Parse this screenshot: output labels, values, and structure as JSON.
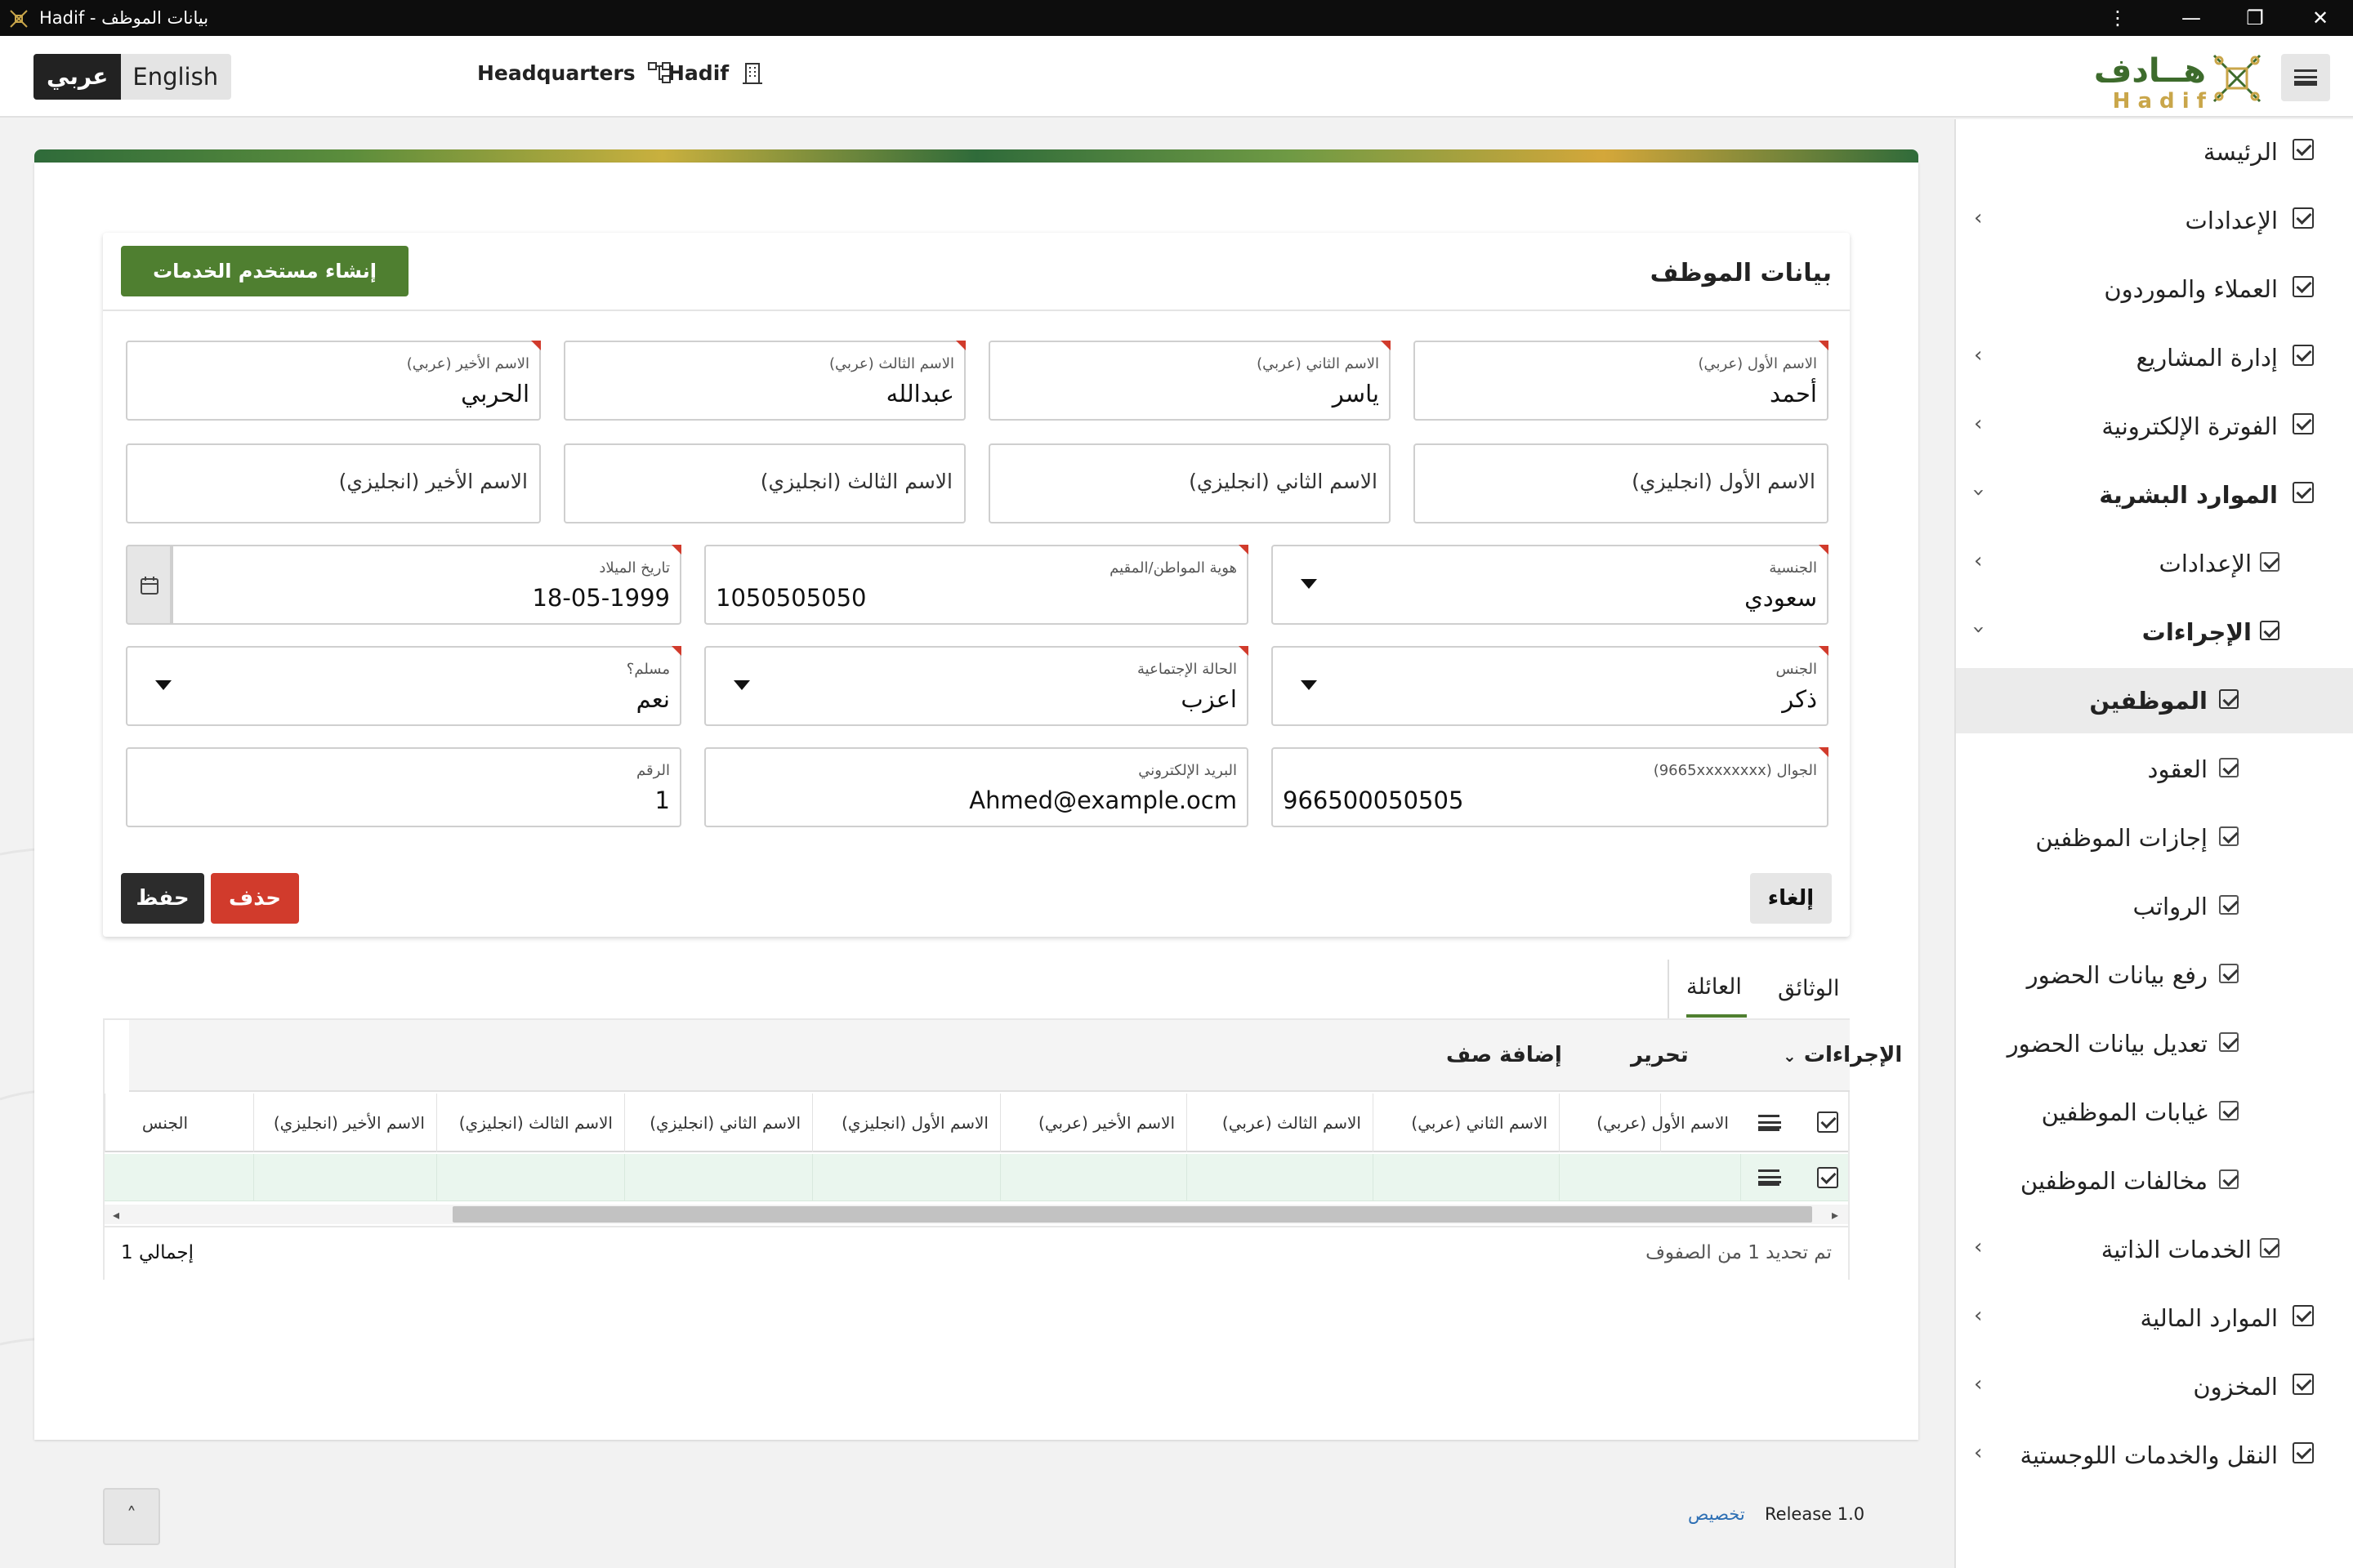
{
  "window": {
    "title": "Hadif - بيانات الموظف"
  },
  "header": {
    "lang_arabic": "عربي",
    "lang_english": "English",
    "org_unit": "Headquarters",
    "company": "Hadif",
    "logo_arabic": "هــادف",
    "logo_latin": "H a d i f"
  },
  "sidebar": {
    "items": [
      {
        "label": "الرئيسة"
      },
      {
        "label": "الإعدادات"
      },
      {
        "label": "العملاء والموردون"
      },
      {
        "label": "إدارة المشاريع"
      },
      {
        "label": "الفوترة الإلكترونية"
      },
      {
        "label": "الموارد البشرية"
      },
      {
        "label": "الإعدادات"
      },
      {
        "label": "الإجراءات"
      },
      {
        "label": "الموظفين"
      },
      {
        "label": "العقود"
      },
      {
        "label": "إجازات الموظفين"
      },
      {
        "label": "الرواتب"
      },
      {
        "label": "رفع بيانات الحضور"
      },
      {
        "label": "تعديل بيانات الحضور"
      },
      {
        "label": "غيابات الموظفين"
      },
      {
        "label": "مخالفات الموظفين"
      },
      {
        "label": "الخدمات الذاتية"
      },
      {
        "label": "الموارد المالية"
      },
      {
        "label": "المخزون"
      },
      {
        "label": "النقل والخدمات اللوجستية"
      }
    ]
  },
  "form": {
    "title": "بيانات الموظف",
    "create_self_service_button": "إنشاء مستخدم الخدمات الذاتية",
    "first_name_ar": {
      "label": "الاسم الأول (عربي)",
      "value": "أحمد"
    },
    "second_name_ar": {
      "label": "الاسم الثاني (عربي)",
      "value": "ياسر"
    },
    "third_name_ar": {
      "label": "الاسم الثالث (عربي)",
      "value": "عبدالله"
    },
    "last_name_ar": {
      "label": "الاسم الأخير (عربي)",
      "value": "الحربي"
    },
    "first_name_en": {
      "placeholder": "الاسم الأول (انجليزي)"
    },
    "second_name_en": {
      "placeholder": "الاسم الثاني (انجليزي)"
    },
    "third_name_en": {
      "placeholder": "الاسم الثالث (انجليزي)"
    },
    "last_name_en": {
      "placeholder": "الاسم الأخير (انجليزي)"
    },
    "nationality": {
      "label": "الجنسية",
      "value": "سعودي"
    },
    "national_id": {
      "label": "هوية المواطن/المقيم",
      "value": "1050505050"
    },
    "birth_date": {
      "label": "تاريخ الميلاد",
      "value": "18-05-1999"
    },
    "gender": {
      "label": "الجنس",
      "value": "ذكر"
    },
    "marital_status": {
      "label": "الحالة الإجتماعية",
      "value": "اعزب"
    },
    "muslim": {
      "label": "مسلم؟",
      "value": "نعم"
    },
    "mobile": {
      "label": "الجوال (9665xxxxxxxx)",
      "value": "966500050505"
    },
    "email": {
      "label": "البريد الإلكتروني",
      "value": "Ahmed@example.ocm"
    },
    "number": {
      "label": "الرقم",
      "value": "1"
    },
    "save_button": "حفظ",
    "delete_button": "حذف",
    "cancel_button": "إلغاء"
  },
  "tabs": {
    "documents": "الوثائق",
    "family": "العائلة"
  },
  "grid": {
    "actions_menu": "الإجراءات",
    "edit": "تحرير",
    "add_row": "إضافة صف",
    "columns": [
      "الاسم الأول (عربي)",
      "الاسم الثاني (عربي)",
      "الاسم الثالث (عربي)",
      "الاسم الأخير (عربي)",
      "الاسم الأول (انجليزي)",
      "الاسم الثاني (انجليزي)",
      "الاسم الثالث (انجليزي)",
      "الاسم الأخير (انجليزي)",
      "الجنس"
    ],
    "selection_status": "تم تحديد 1 من الصفوف",
    "total": "إجمالي 1"
  },
  "footer": {
    "release": "Release 1.0",
    "customize": "تخصيص"
  },
  "colors": {
    "brand_green": "#4f7f30",
    "delete_red": "#d13b2c",
    "dark_button": "#2c2c2c",
    "selected_row": "#eaf6ee",
    "logo_gold": "#c9a64a"
  }
}
